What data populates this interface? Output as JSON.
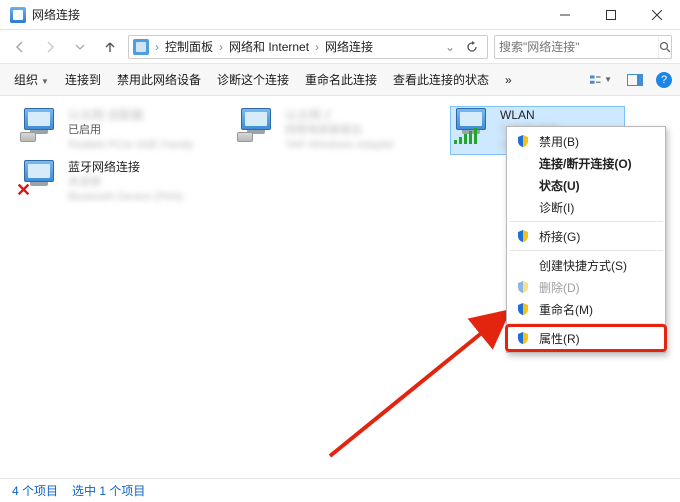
{
  "window": {
    "title": "网络连接"
  },
  "breadcrumbs": [
    "控制面板",
    "网络和 Internet",
    "网络连接"
  ],
  "search": {
    "placeholder": "搜索\"网络连接\""
  },
  "toolbar": {
    "organize": "组织",
    "connect": "连接到",
    "disable": "禁用此网络设备",
    "diagnose": "诊断这个连接",
    "rename": "重命名此连接",
    "viewstatus": "查看此连接的状态",
    "more": "»"
  },
  "items": [
    {
      "name": "WLAN"
    },
    {
      "name": "蓝牙网络连接"
    },
    {
      "status_enabled": "已启用"
    }
  ],
  "context_menu": {
    "disable": "禁用(B)",
    "connect_disconnect": "连接/断开连接(O)",
    "status": "状态(U)",
    "diagnose": "诊断(I)",
    "bridge": "桥接(G)",
    "shortcut": "创建快捷方式(S)",
    "delete": "删除(D)",
    "rename": "重命名(M)",
    "properties": "属性(R)"
  },
  "statusbar": {
    "count": "4 个项目",
    "selected": "选中 1 个项目"
  }
}
